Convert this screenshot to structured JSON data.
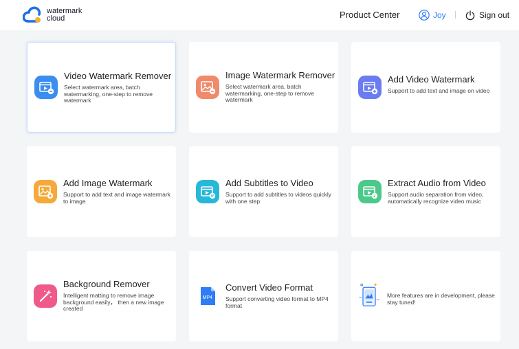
{
  "header": {
    "logo_line1": "watermark",
    "logo_line2": "cloud",
    "product_center": "Product Center",
    "user_name": "Joy",
    "sign_out": "Sign out"
  },
  "colors": {
    "accent": "#2e7cf6",
    "video_remover": "#3a8ef0",
    "image_remover": "#f08a6a",
    "add_video_wm": "#6b7bf2",
    "add_image_wm": "#f5a93a",
    "subtitles": "#27b7d8",
    "extract_audio": "#4cc98a",
    "bg_remover": "#f05a8a",
    "convert": "#2e7cf6"
  },
  "cards": [
    {
      "title": "Video Watermark Remover",
      "desc": "Select watermark area, batch watermarking, one-step to remove watermark",
      "icon": "video-remove-icon"
    },
    {
      "title": "Image Watermark Remover",
      "desc": "Select watermark area, batch watermarking, one-step to remove watermark",
      "icon": "image-remove-icon"
    },
    {
      "title": "Add Video Watermark",
      "desc": "Support to add text and image on video",
      "icon": "video-add-icon"
    },
    {
      "title": "Add Image Watermark",
      "desc": "Support to add text and image watermark to image",
      "icon": "image-add-icon"
    },
    {
      "title": "Add Subtitles to Video",
      "desc": "Support to add subtitles to videos quickly with one step",
      "icon": "subtitle-icon"
    },
    {
      "title": "Extract Audio from Video",
      "desc": "Support audio separation from video, automatically recognize video music",
      "icon": "audio-extract-icon"
    },
    {
      "title": "Background Remover",
      "desc": "Intelligent matting to remove image background easily， then a new image created",
      "icon": "magic-wand-icon"
    },
    {
      "title": "Convert Video Format",
      "desc": "Support converting video format to MP4 format",
      "icon": "mp4-file-icon",
      "icon_label": "MP4"
    },
    {
      "note": "More features are in development, please stay tuned!",
      "icon": "phone-development-icon"
    }
  ]
}
